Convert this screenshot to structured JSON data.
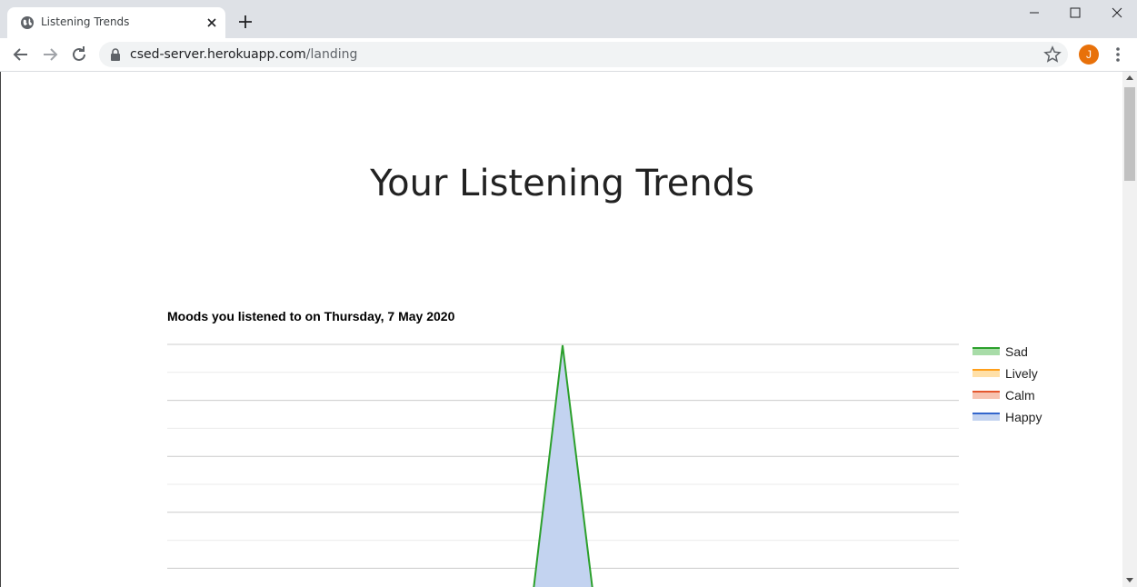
{
  "browser": {
    "tab_title": "Listening Trends",
    "url_host": "csed-server.herokuapp.com",
    "url_path": "/landing",
    "avatar_letter": "J",
    "avatar_color": "#e8710a"
  },
  "page": {
    "title": "Your Listening Trends"
  },
  "chart_data": {
    "type": "area",
    "title": "Moods you listened to on Thursday, 7 May 2020",
    "legend_position": "right",
    "grid": true,
    "series": [
      {
        "name": "Sad",
        "color": "#2ca02c",
        "fill": "#a8dca8"
      },
      {
        "name": "Lively",
        "color": "#ff9f1a",
        "fill": "#ffe0a8"
      },
      {
        "name": "Calm",
        "color": "#e4572e",
        "fill": "#f7c3b0"
      },
      {
        "name": "Happy",
        "color": "#3366cc",
        "fill": "#c3d3f0"
      }
    ]
  }
}
